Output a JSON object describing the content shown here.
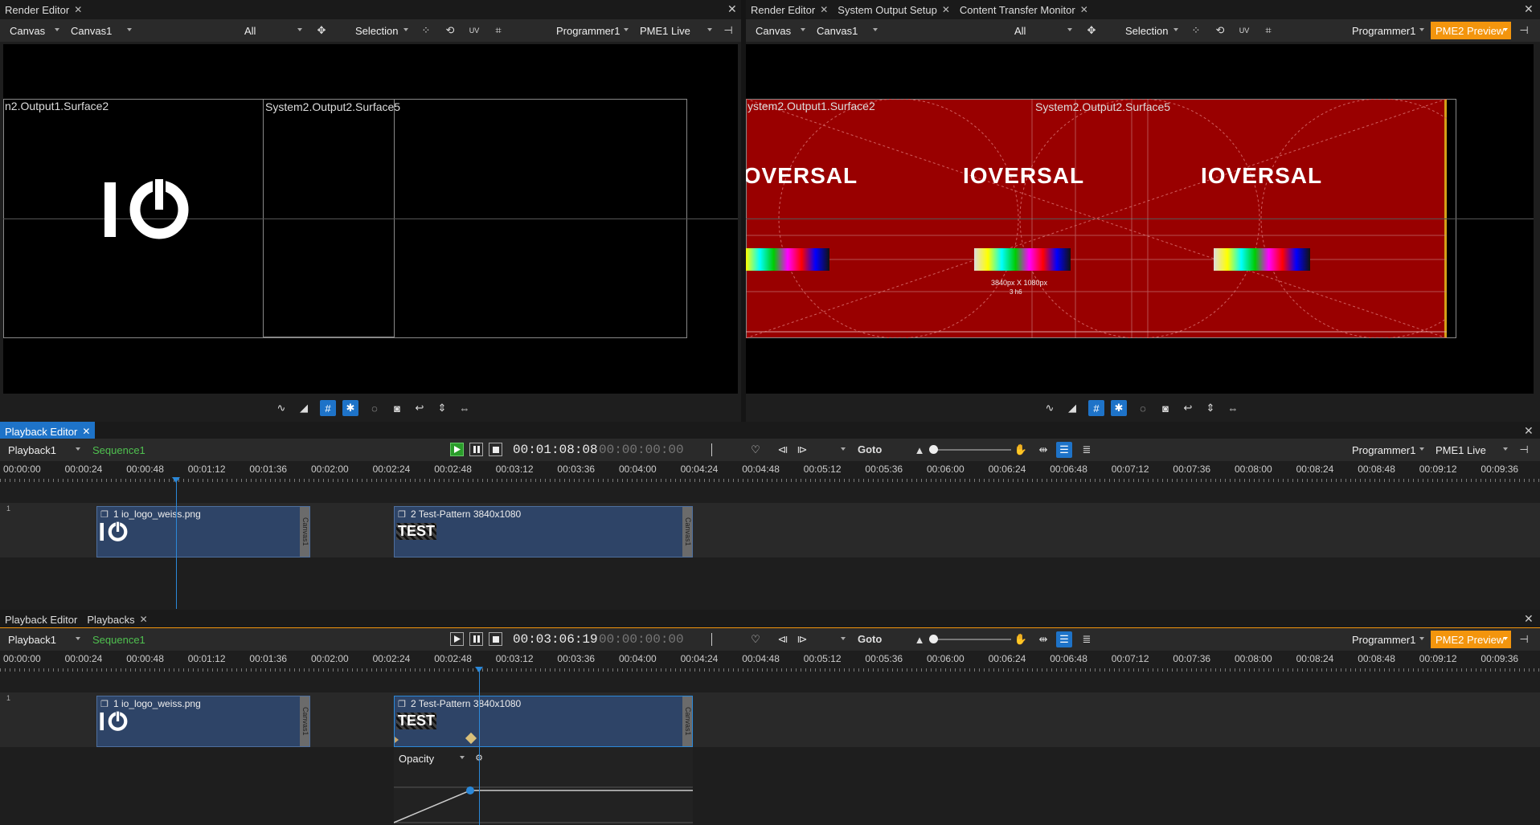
{
  "left_render": {
    "tab": "Render Editor",
    "view_mode": "Canvas",
    "canvas": "Canvas1",
    "filter": "All",
    "tool": "Selection",
    "programmer": "Programmer1",
    "mode": "PME1 Live",
    "surface_a": "n2.Output1.Surface2",
    "surface_b": "System2.Output2.Surface5"
  },
  "right_render": {
    "tabs": [
      "Render Editor",
      "System Output Setup",
      "Content Transfer Monitor"
    ],
    "view_mode": "Canvas",
    "canvas": "Canvas1",
    "filter": "All",
    "tool": "Selection",
    "programmer": "Programmer1",
    "mode": "PME2 Preview",
    "surface_a": "ystem2.Output1.Surface2",
    "surface_b": "System2.Output2.Surface5",
    "pattern_logo": "IOVERSAL",
    "pattern_res": "3840px X 1080px",
    "pattern_sub": "3 h6"
  },
  "pb1": {
    "tab": "Playback Editor",
    "playback": "Playback1",
    "sequence": "Sequence1",
    "timecode": "00:01:08:08",
    "timecode2": "00:00:00:00",
    "goto": "Goto",
    "programmer": "Programmer1",
    "mode": "PME1 Live",
    "layer": "1",
    "clip1": "1 io_logo_weiss.png",
    "clip2": "2 Test-Pattern 3840x1080",
    "canvas_tag": "Canvas1",
    "test_thumb": "TEST"
  },
  "pb2": {
    "tabs": [
      "Playback Editor",
      "Playbacks"
    ],
    "playback": "Playback1",
    "sequence": "Sequence1",
    "timecode": "00:03:06:19",
    "timecode2": "00:00:00:00",
    "goto": "Goto",
    "programmer": "Programmer1",
    "mode": "PME2 Preview",
    "layer": "1",
    "clip1": "1 io_logo_weiss.png",
    "clip2": "2 Test-Pattern 3840x1080",
    "canvas_tag": "Canvas1",
    "test_thumb": "TEST",
    "curve_param": "Opacity"
  },
  "ruler_ticks": [
    "00:00:00",
    "00:00:24",
    "00:00:48",
    "00:01:12",
    "00:01:36",
    "00:02:00",
    "00:02:24",
    "00:02:48",
    "00:03:12",
    "00:03:36",
    "00:04:00",
    "00:04:24",
    "00:04:48",
    "00:05:12",
    "00:05:36",
    "00:06:00",
    "00:06:24",
    "00:06:48",
    "00:07:12",
    "00:07:36",
    "00:08:00",
    "00:08:24",
    "00:08:48",
    "00:09:12",
    "00:09:36"
  ],
  "colors": {
    "accent": "#1e73c8",
    "preview": "#f3950d",
    "sequence": "#4fc04f",
    "pattern": "#990000"
  }
}
